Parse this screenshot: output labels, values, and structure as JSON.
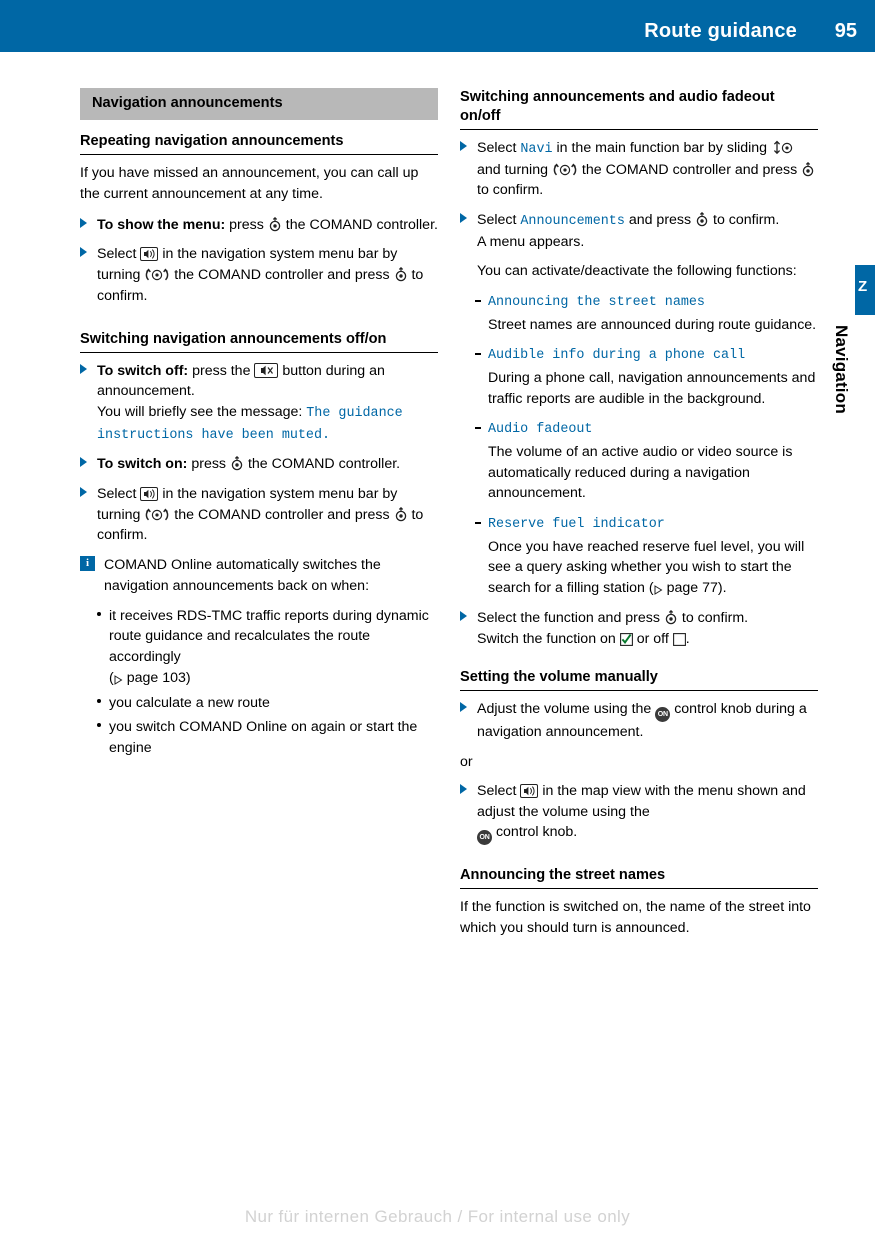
{
  "header": {
    "title": "Route guidance",
    "page": "95"
  },
  "side_tab": {
    "label": "Navigation",
    "mark": "Z"
  },
  "left": {
    "section_band": "Navigation announcements",
    "sub1": "Repeating navigation announcements",
    "p1": "If you have missed an announcement, you can call up the current announcement at any time.",
    "item1_bold": "To show the menu:",
    "item1_rest_a": "press",
    "item1_rest_b": "the COMAND controller.",
    "item2_a": "Select",
    "item2_b": "in the navigation system menu bar by turning",
    "item2_c": "the COMAND controller and press",
    "item2_d": "to confirm.",
    "sub2": "Switching navigation announcements off/on",
    "item3_bold": "To switch off:",
    "item3_a": "press the",
    "item3_b": "button during an announcement.",
    "item3_c": "You will briefly see the message:",
    "item3_mono": "The guidance instructions have been muted.",
    "item4_bold": "To switch on:",
    "item4_a": "press",
    "item4_b": "the COMAND controller.",
    "item5_a": "Select",
    "item5_b": "in the navigation system menu bar by turning",
    "item5_c": "the COMAND controller and press",
    "item5_d": "to confirm.",
    "info": "COMAND Online automatically switches the navigation announcements back on when:",
    "bullets": [
      "it receives RDS-TMC traffic reports during dynamic route guidance and recalculates the route accordingly",
      "you calculate a new route",
      "you switch COMAND Online on again or start the engine"
    ],
    "bullet1_ref": "page 103"
  },
  "right": {
    "sub1": "Switching announcements and audio fadeout on/off",
    "item1_a": "Select",
    "item1_mono": "Navi",
    "item1_b": "in the main function bar by sliding",
    "item1_c": "and turning",
    "item1_d": "the COMAND controller and press",
    "item1_e": "to confirm.",
    "item2_a": "Select",
    "item2_mono": "Announcements",
    "item2_b": "and press",
    "item2_c": "to confirm.",
    "item2_d": "A menu appears.",
    "item2_e": "You can activate/deactivate the following functions:",
    "options": [
      {
        "name": "Announcing the street names",
        "desc": "Street names are announced during route guidance."
      },
      {
        "name": "Audible info during a phone call",
        "desc": "During a phone call, navigation announcements and traffic reports are audible in the background."
      },
      {
        "name": "Audio fadeout",
        "desc": "The volume of an active audio or video source is automatically reduced during a navigation announcement."
      },
      {
        "name": "Reserve fuel indicator",
        "desc": "Once you have reached reserve fuel level, you will see a query asking whether you wish to start the search for a filling station",
        "ref": "page 77"
      }
    ],
    "item3_a": "Select the function and press",
    "item3_b": "to confirm.",
    "item3_c": "Switch the function on",
    "item3_d": "or off",
    "sub2": "Setting the volume manually",
    "item4_a": "Adjust the volume using the",
    "item4_b": "control knob during a navigation announcement.",
    "or": "or",
    "item5_a": "Select",
    "item5_b": "in the map view with the menu shown and adjust the volume using the",
    "item5_c": "control knob.",
    "sub3": "Announcing the street names",
    "p_last": "If the function is switched on, the name of the street into which you should turn is announced."
  },
  "footer": "Nur für internen Gebrauch / For internal use only",
  "colors": {
    "accent": "#0067a5",
    "band": "#b8b8b8",
    "mono_text": "#0067a5",
    "footer_text": "#d2d2d2"
  }
}
